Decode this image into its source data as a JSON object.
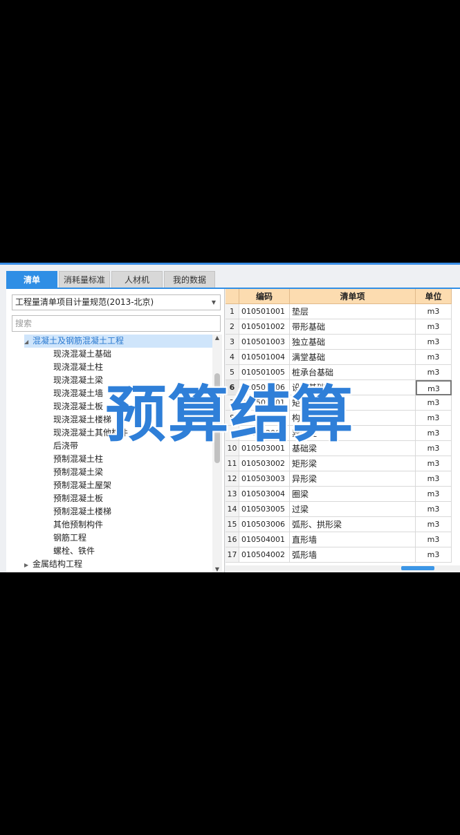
{
  "tabs": [
    {
      "label": "清单",
      "active": true
    },
    {
      "label": "消耗量标准",
      "active": false
    },
    {
      "label": "人材机",
      "active": false
    },
    {
      "label": "我的数据",
      "active": false
    }
  ],
  "left": {
    "select_value": "工程量清单项目计量规范(2013-北京)",
    "search_placeholder": "搜索",
    "tree": [
      {
        "label": "混凝土及钢筋混凝土工程",
        "level": 1,
        "expanded": true,
        "selected": true
      },
      {
        "label": "现浇混凝土基础",
        "level": 2
      },
      {
        "label": "现浇混凝土柱",
        "level": 2
      },
      {
        "label": "现浇混凝土梁",
        "level": 2
      },
      {
        "label": "现浇混凝土墙",
        "level": 2
      },
      {
        "label": "现浇混凝土板",
        "level": 2
      },
      {
        "label": "现浇混凝土楼梯",
        "level": 2
      },
      {
        "label": "现浇混凝土其他构件",
        "level": 2
      },
      {
        "label": "后浇带",
        "level": 2
      },
      {
        "label": "预制混凝土柱",
        "level": 2
      },
      {
        "label": "预制混凝土梁",
        "level": 2
      },
      {
        "label": "预制混凝土屋架",
        "level": 2
      },
      {
        "label": "预制混凝土板",
        "level": 2
      },
      {
        "label": "预制混凝土楼梯",
        "level": 2
      },
      {
        "label": "其他预制构件",
        "level": 2
      },
      {
        "label": "钢筋工程",
        "level": 2
      },
      {
        "label": "螺栓、铁件",
        "level": 2
      },
      {
        "label": "金属结构工程",
        "level": 1,
        "expanded": false
      }
    ]
  },
  "grid": {
    "headers": [
      "",
      "编码",
      "清单项",
      "单位"
    ],
    "rows": [
      {
        "no": "1",
        "code": "010501001",
        "name": "垫层",
        "unit": "m3"
      },
      {
        "no": "2",
        "code": "010501002",
        "name": "带形基础",
        "unit": "m3"
      },
      {
        "no": "3",
        "code": "010501003",
        "name": "独立基础",
        "unit": "m3"
      },
      {
        "no": "4",
        "code": "010501004",
        "name": "满堂基础",
        "unit": "m3"
      },
      {
        "no": "5",
        "code": "010501005",
        "name": "桩承台基础",
        "unit": "m3"
      },
      {
        "no": "6",
        "code": "010501006",
        "name": "设备基础",
        "unit": "m3",
        "current": true
      },
      {
        "no": "7",
        "code": "010502001",
        "name": "矩形柱",
        "unit": "m3"
      },
      {
        "no": "8",
        "code": "010502002",
        "name": "构造柱",
        "unit": "m3"
      },
      {
        "no": "9",
        "code": "010502003",
        "name": "异形柱",
        "unit": "m3"
      },
      {
        "no": "10",
        "code": "010503001",
        "name": "基础梁",
        "unit": "m3"
      },
      {
        "no": "11",
        "code": "010503002",
        "name": "矩形梁",
        "unit": "m3"
      },
      {
        "no": "12",
        "code": "010503003",
        "name": "异形梁",
        "unit": "m3"
      },
      {
        "no": "13",
        "code": "010503004",
        "name": "圈梁",
        "unit": "m3"
      },
      {
        "no": "14",
        "code": "010503005",
        "name": "过梁",
        "unit": "m3"
      },
      {
        "no": "15",
        "code": "010503006",
        "name": "弧形、拱形梁",
        "unit": "m3"
      },
      {
        "no": "16",
        "code": "010504001",
        "name": "直形墙",
        "unit": "m3"
      },
      {
        "no": "17",
        "code": "010504002",
        "name": "弧形墙",
        "unit": "m3"
      }
    ]
  },
  "overlay_text": "预算结算",
  "colors": {
    "accent": "#2f8ee5",
    "header": "#fcdcb0",
    "overlay": "#2f7fd8"
  }
}
